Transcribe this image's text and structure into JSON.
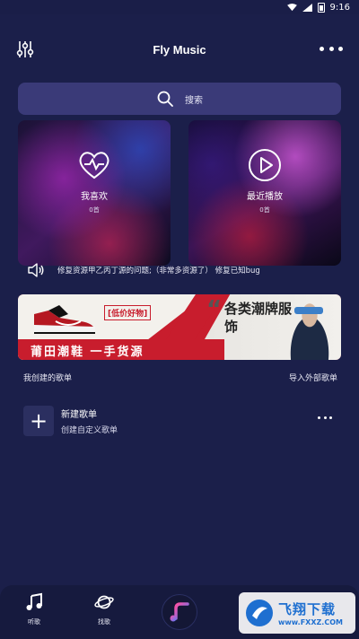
{
  "status_bar": {
    "time": "9:16"
  },
  "header": {
    "title": "Fly Music"
  },
  "search": {
    "placeholder": "搜索"
  },
  "cards": [
    {
      "label": "我喜欢",
      "count": "0首",
      "icon": "heart-pulse-icon"
    },
    {
      "label": "最近播放",
      "count": "0首",
      "icon": "play-circle-icon"
    }
  ],
  "notice": {
    "text": "修复资源甲乙丙丁源的问题;（非常多资源了） 修复已知bug"
  },
  "banner": {
    "tag": "[低价好物]",
    "left_text": "莆田潮鞋 一手货源",
    "right_text": "各类潮牌服饰"
  },
  "playlists_section": {
    "title": "我创建的歌单",
    "import_label": "导入外部歌单"
  },
  "new_playlist": {
    "title": "新建歌单",
    "subtitle": "创建自定义歌单"
  },
  "tabbar": {
    "tabs": [
      {
        "label": "听歌",
        "icon": "music-note-icon"
      },
      {
        "label": "找歌",
        "icon": "planet-icon"
      }
    ]
  },
  "watermark": {
    "name": "飞翔下载",
    "url": "www.FXXZ.COM"
  },
  "colors": {
    "background": "#1b1f4a",
    "search_bg": "#3a3a78",
    "tabbar_bg": "#161a3e",
    "banner_red": "#c81d2d",
    "accent_pink": "#ff4fa3",
    "accent_blue": "#4f7dff"
  }
}
